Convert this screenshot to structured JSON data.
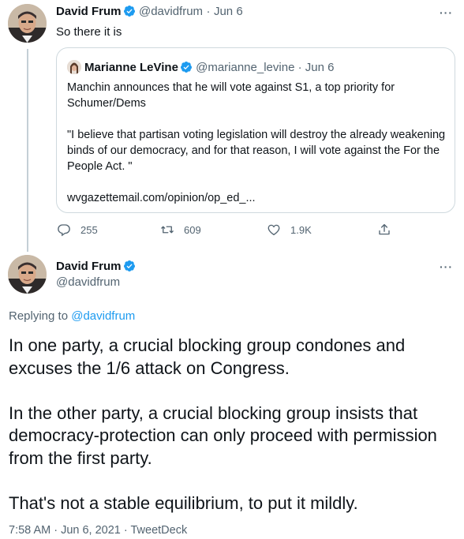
{
  "colors": {
    "accent": "#1d9bf0",
    "muted": "#536471",
    "text": "#0f1419",
    "border": "#cfd9de"
  },
  "tweet1": {
    "name": "David Frum",
    "handle": "@davidfrum",
    "separator": "·",
    "date": "Jun 6",
    "text": "So there it is",
    "more_label": "···",
    "quote": {
      "name": "Marianne LeVine",
      "handle": "@marianne_levine",
      "separator": "·",
      "date": "Jun 6",
      "paragraphs": [
        "Manchin announces that he will vote against S1, a top priority for Schumer/Dems",
        "\"I believe that partisan voting legislation will destroy the already weakening binds of our democracy, and for that reason, I will vote against the For the People Act. \"",
        "wvgazettemail.com/opinion/op_ed_..."
      ]
    },
    "actions": {
      "reply_count": "255",
      "retweet_count": "609",
      "like_count": "1.9K",
      "icons": [
        "reply-icon",
        "retweet-icon",
        "like-icon",
        "share-icon"
      ]
    }
  },
  "tweet2": {
    "name": "David Frum",
    "handle": "@davidfrum",
    "more_label": "···",
    "replying_prefix": "Replying to",
    "replying_to": "@davidfrum",
    "paragraphs": [
      "In one party, a crucial blocking group condones and excuses the 1/6 attack on Congress.",
      "In the other party, a crucial blocking group insists that democracy-protection can only proceed with permission from the first party.",
      "That's not a stable equilibrium, to put it mildly."
    ],
    "timestamp": "7:58 AM · Jun 6, 2021 · TweetDeck"
  }
}
